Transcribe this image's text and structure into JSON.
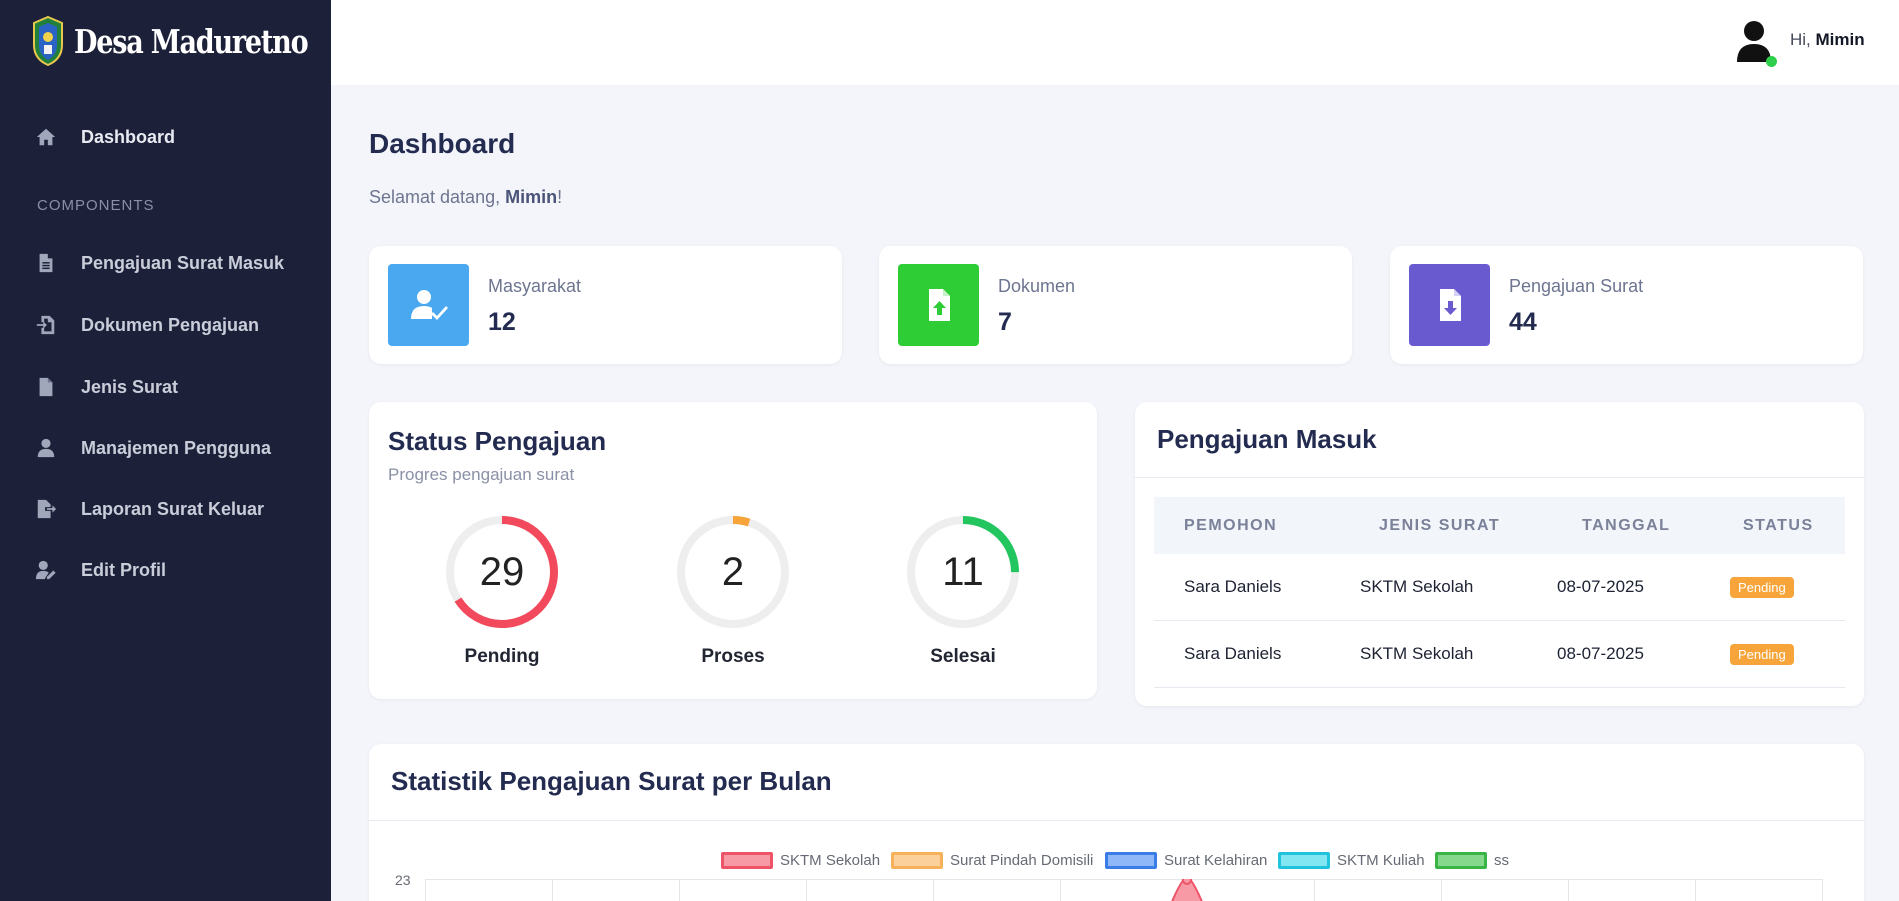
{
  "brand": {
    "name": "Desa Maduretno"
  },
  "sidebar": {
    "section_label": "COMPONENTS",
    "items": [
      {
        "label": "Dashboard",
        "icon": "home-icon"
      },
      {
        "label": "Pengajuan Surat Masuk",
        "icon": "file-icon"
      },
      {
        "label": "Dokumen Pengajuan",
        "icon": "file-import-icon"
      },
      {
        "label": "Jenis Surat",
        "icon": "file-icon"
      },
      {
        "label": "Manajemen Pengguna",
        "icon": "user-icon"
      },
      {
        "label": "Laporan Surat Keluar",
        "icon": "file-export-icon"
      },
      {
        "label": "Edit Profil",
        "icon": "user-edit-icon"
      }
    ]
  },
  "topbar": {
    "greeting_prefix": "Hi,",
    "user_name": "Mimin",
    "status_color": "#2fce4b"
  },
  "main": {
    "title": "Dashboard",
    "welcome_prefix": "Selamat datang,",
    "welcome_name": "Mimin",
    "welcome_suffix": "!"
  },
  "stats": [
    {
      "label": "Masyarakat",
      "value": "12",
      "color": "#4aa8f0",
      "icon": "user-check-icon"
    },
    {
      "label": "Dokumen",
      "value": "7",
      "color": "#2ecc35",
      "icon": "file-upload-icon"
    },
    {
      "label": "Pengajuan Surat",
      "value": "44",
      "color": "#6a5ad0",
      "icon": "file-download-icon"
    }
  ],
  "status_card": {
    "title": "Status Pengajuan",
    "subtitle": "Progres pengajuan surat",
    "items": [
      {
        "label": "Pending",
        "value": "29",
        "fraction": 0.66,
        "color": "#f2495c"
      },
      {
        "label": "Proses",
        "value": "2",
        "fraction": 0.05,
        "color": "#f7a53a"
      },
      {
        "label": "Selesai",
        "value": "11",
        "fraction": 0.25,
        "color": "#22c55e"
      }
    ]
  },
  "incoming": {
    "title": "Pengajuan Masuk",
    "headers": [
      "PEMOHON",
      "JENIS SURAT",
      "TANGGAL",
      "STATUS"
    ],
    "rows": [
      {
        "pemohon": "Sara Daniels",
        "jenis": "SKTM Sekolah",
        "tanggal": "08-07-2025",
        "status": "Pending"
      },
      {
        "pemohon": "Sara Daniels",
        "jenis": "SKTM Sekolah",
        "tanggal": "08-07-2025",
        "status": "Pending"
      }
    ]
  },
  "monthly": {
    "title": "Statistik Pengajuan Surat per Bulan",
    "y_max_label": "23",
    "legend": [
      {
        "name": "SKTM Sekolah",
        "fill": "#f79aa6",
        "stroke": "#ee5468"
      },
      {
        "name": "Surat Pindah Domisili",
        "fill": "#fbd09a",
        "stroke": "#f6b15a"
      },
      {
        "name": "Surat Kelahiran",
        "fill": "#8eb8f7",
        "stroke": "#3b7de6"
      },
      {
        "name": "SKTM Kuliah",
        "fill": "#82e6f2",
        "stroke": "#1fc3db"
      },
      {
        "name": "ss",
        "fill": "#86d98c",
        "stroke": "#3ab545"
      }
    ]
  }
}
